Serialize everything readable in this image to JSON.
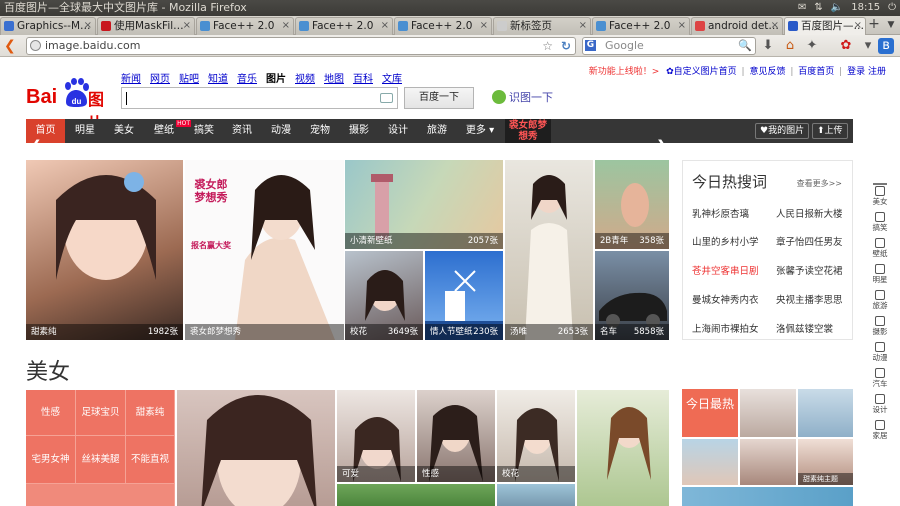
{
  "window": {
    "title": "百度图片—全球最大中文图片库 - Mozilla Firefox",
    "clock": "18:15",
    "tray_icons": [
      "mail-icon",
      "network-icon",
      "volume-icon",
      "clock",
      "power-icon"
    ]
  },
  "tabs": [
    {
      "label": "Graphics--M…",
      "favicon_color": "#3a6fd0"
    },
    {
      "label": "使用MaskFil…",
      "favicon_color": "#c8161d"
    },
    {
      "label": "Face++ 2.0",
      "favicon_color": "#4a8fd1"
    },
    {
      "label": "Face++ 2.0",
      "favicon_color": "#4a8fd1"
    },
    {
      "label": "Face++ 2.0",
      "favicon_color": "#4a8fd1"
    },
    {
      "label": "新标签页",
      "favicon_color": "#cccccc"
    },
    {
      "label": "Face++ 2.0",
      "favicon_color": "#4a8fd1"
    },
    {
      "label": "android det…",
      "favicon_color": "#d44"
    },
    {
      "label": "百度图片—…",
      "favicon_color": "#2a5ac8",
      "active": true
    }
  ],
  "navbar": {
    "url": "image.baidu.com",
    "search_engine": "G",
    "search_placeholder": "Google"
  },
  "page": {
    "top_links": {
      "new_feature": "新功能上线啦！>",
      "customize": "自定义图片首页",
      "feedback": "意见反馈",
      "baidu_home": "百度首页",
      "login": "登录",
      "register": "注册"
    },
    "logo": {
      "bai": "Bai",
      "tu": "图片"
    },
    "categories": [
      "新闻",
      "网页",
      "贴吧",
      "知道",
      "音乐",
      "图片",
      "视频",
      "地图",
      "百科",
      "文库"
    ],
    "current_category": "图片",
    "search_button": "百度一下",
    "shitu": "识图一下",
    "nav": {
      "items": [
        "首页",
        "明星",
        "美女",
        "壁纸",
        "搞笑",
        "资讯",
        "动漫",
        "宠物",
        "摄影",
        "设计",
        "旅游",
        "更多"
      ],
      "hot_badge": "HOT",
      "promo": "裘女郎梦想秀",
      "my_images": "我的图片",
      "upload": "上传"
    },
    "mosaic": [
      {
        "caption": "甜素纯",
        "count": "1982张"
      },
      {
        "caption": "裘女郎梦想秀",
        "count": "",
        "promo_line1": "裘女郎",
        "promo_line2": "梦想秀",
        "promo_line3": "报名赢大奖"
      },
      {
        "caption": "小清新壁纸",
        "count": "2057张"
      },
      {
        "caption": "校花",
        "count": "3649张"
      },
      {
        "caption": "情人节壁纸",
        "count": "230张"
      },
      {
        "caption": "汤唯",
        "count": "2653张"
      },
      {
        "caption": "2B青年",
        "count": "358张"
      },
      {
        "caption": "名车",
        "count": "5858张"
      }
    ],
    "hot": {
      "title": "今日热搜词",
      "more": "查看更多>>",
      "rows": [
        [
          "乳神杉原杏璃",
          "人民日报新大楼"
        ],
        [
          "山里的乡村小学",
          "章子怡四任男友"
        ],
        [
          "苍井空客串日剧",
          "张馨予读空花裙"
        ],
        [
          "曼城女神秀内衣",
          "央视主播李思思"
        ],
        [
          "上海闹市裸拍女",
          "洛佩兹镂空裳"
        ]
      ],
      "red_cell": "苍井空客串日剧"
    },
    "section": {
      "title": "美女",
      "tags": [
        [
          "性感",
          "足球宝贝",
          "甜素纯"
        ],
        [
          "宅男女神",
          "丝袜美腿",
          "不能直视"
        ]
      ],
      "photo_captions": [
        "可爱",
        "性感",
        "校花"
      ],
      "today_label": "今日最热",
      "mini_caption": "甜素纯主题"
    },
    "sidebar": [
      "美女",
      "搞笑",
      "壁纸",
      "明星",
      "旅游",
      "摄影",
      "动漫",
      "汽车",
      "设计",
      "家居"
    ]
  }
}
